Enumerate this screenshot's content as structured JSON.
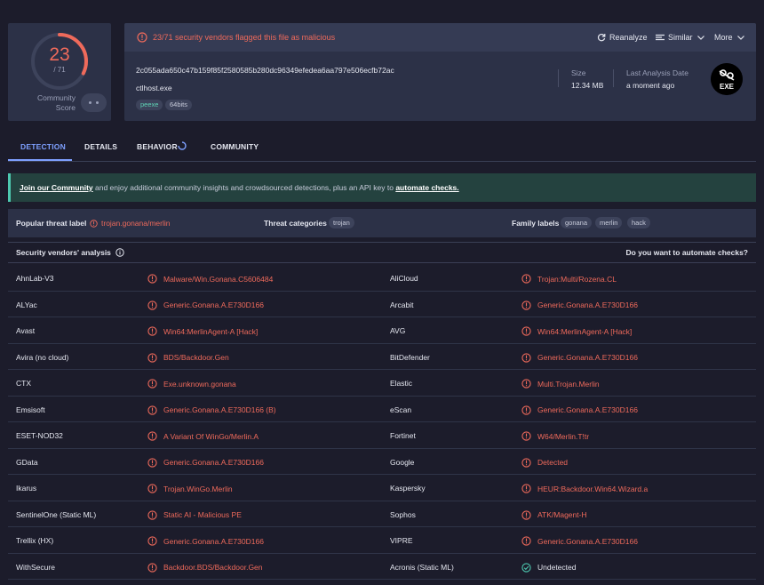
{
  "score": {
    "detections": "23",
    "total": "/ 71",
    "detection_fraction": 0.324,
    "community_label_line1": "Community",
    "community_label_line2": "Score"
  },
  "file": {
    "alert": "23/71 security vendors flagged this file as malicious",
    "actions": {
      "reanalyze": "Reanalyze",
      "similar": "Similar",
      "more": "More"
    },
    "hash": "2c055ada650c47b159f85f2580585b280dc96349efedea6aa797e506ecfb72ac",
    "name": "ctlhost.exe",
    "tags": [
      "peexe",
      "64bits"
    ],
    "size_label": "Size",
    "size_value": "12.34 MB",
    "last_analysis_label": "Last Analysis Date",
    "last_analysis_value": "a moment ago",
    "type_icon_text": "EXE"
  },
  "tabs": [
    "DETECTION",
    "DETAILS",
    "BEHAVIOR",
    "COMMUNITY"
  ],
  "banner": {
    "link1": "Join our Community",
    "text": " and enjoy additional community insights and crowdsourced detections, plus an API key to ",
    "link2": "automate checks."
  },
  "threat": {
    "popular_label": "Popular threat label",
    "popular_value": "trojan.gonana/merlin",
    "categories_label": "Threat categories",
    "categories": [
      "trojan"
    ],
    "family_label": "Family labels",
    "families": [
      "gonana",
      "merlin",
      "hack"
    ]
  },
  "vendors_section": {
    "title": "Security vendors' analysis",
    "automate": "Do you want to automate checks?"
  },
  "vendors": [
    [
      {
        "name": "AhnLab-V3",
        "result": "Malware/Win.Gonana.C5606484",
        "status": "malicious"
      },
      {
        "name": "AliCloud",
        "result": "Trojan:Multi/Rozena.CL",
        "status": "malicious"
      }
    ],
    [
      {
        "name": "ALYac",
        "result": "Generic.Gonana.A.E730D166",
        "status": "malicious"
      },
      {
        "name": "Arcabit",
        "result": "Generic.Gonana.A.E730D166",
        "status": "malicious"
      }
    ],
    [
      {
        "name": "Avast",
        "result": "Win64:MerlinAgent-A [Hack]",
        "status": "malicious"
      },
      {
        "name": "AVG",
        "result": "Win64:MerlinAgent-A [Hack]",
        "status": "malicious"
      }
    ],
    [
      {
        "name": "Avira (no cloud)",
        "result": "BDS/Backdoor.Gen",
        "status": "malicious"
      },
      {
        "name": "BitDefender",
        "result": "Generic.Gonana.A.E730D166",
        "status": "malicious"
      }
    ],
    [
      {
        "name": "CTX",
        "result": "Exe.unknown.gonana",
        "status": "malicious"
      },
      {
        "name": "Elastic",
        "result": "Multi.Trojan.Merlin",
        "status": "malicious"
      }
    ],
    [
      {
        "name": "Emsisoft",
        "result": "Generic.Gonana.A.E730D166 (B)",
        "status": "malicious"
      },
      {
        "name": "eScan",
        "result": "Generic.Gonana.A.E730D166",
        "status": "malicious"
      }
    ],
    [
      {
        "name": "ESET-NOD32",
        "result": "A Variant Of WinGo/Merlin.A",
        "status": "malicious"
      },
      {
        "name": "Fortinet",
        "result": "W64/Merlin.T!tr",
        "status": "malicious"
      }
    ],
    [
      {
        "name": "GData",
        "result": "Generic.Gonana.A.E730D166",
        "status": "malicious"
      },
      {
        "name": "Google",
        "result": "Detected",
        "status": "malicious"
      }
    ],
    [
      {
        "name": "Ikarus",
        "result": "Trojan.WinGo.Merlin",
        "status": "malicious"
      },
      {
        "name": "Kaspersky",
        "result": "HEUR:Backdoor.Win64.Wizard.a",
        "status": "malicious"
      }
    ],
    [
      {
        "name": "SentinelOne (Static ML)",
        "result": "Static AI - Malicious PE",
        "status": "malicious"
      },
      {
        "name": "Sophos",
        "result": "ATK/Magent-H",
        "status": "malicious"
      }
    ],
    [
      {
        "name": "Trellix (HX)",
        "result": "Generic.Gonana.A.E730D166",
        "status": "malicious"
      },
      {
        "name": "VIPRE",
        "result": "Generic.Gonana.A.E730D166",
        "status": "malicious"
      }
    ],
    [
      {
        "name": "WithSecure",
        "result": "Backdoor.BDS/Backdoor.Gen",
        "status": "malicious"
      },
      {
        "name": "Acronis (Static ML)",
        "result": "Undetected",
        "status": "undetected"
      }
    ]
  ],
  "colors": {
    "malicious": "#ef6a5b",
    "undetected": "#4dc9b0",
    "accent": "#7ea0ff",
    "background": "#1c1c2b",
    "card": "#2c3147"
  }
}
